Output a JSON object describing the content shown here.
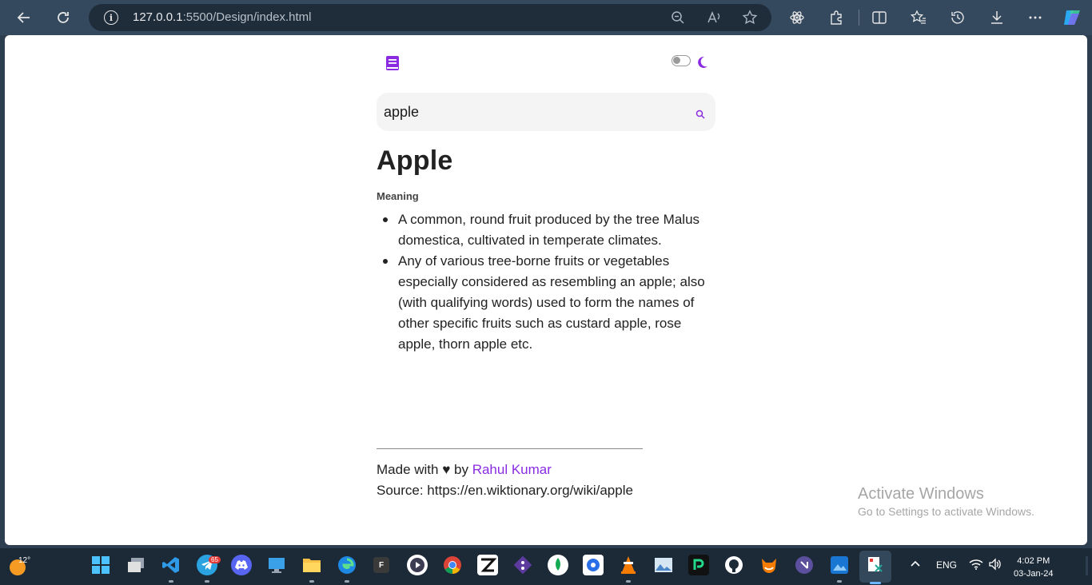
{
  "browser": {
    "url_host": "127.0.0.1",
    "url_rest": ":5500/Design/index.html"
  },
  "page": {
    "search_value": "apple",
    "word": "Apple",
    "meaning_label": "Meaning",
    "definitions": [
      "A common, round fruit produced by the tree Malus domestica, cultivated in temperate climates.",
      "Any of various tree-borne fruits or vegetables especially considered as resembling an apple; also (with qualifying words) used to form the names of other specific fruits such as custard apple, rose apple, thorn apple etc."
    ],
    "footer": {
      "made_with": "Made with ♥ by ",
      "author": "Rahul Kumar",
      "source": "Source: https://en.wiktionary.org/wiki/apple"
    },
    "accent_color": "#8a2be2"
  },
  "watermark": {
    "title": "Activate Windows",
    "subtitle": "Go to Settings to activate Windows."
  },
  "taskbar": {
    "temperature": "12°",
    "telegram_badge": "65",
    "lang": "ENG",
    "time": "4:02 PM",
    "date": "03-Jan-24"
  }
}
